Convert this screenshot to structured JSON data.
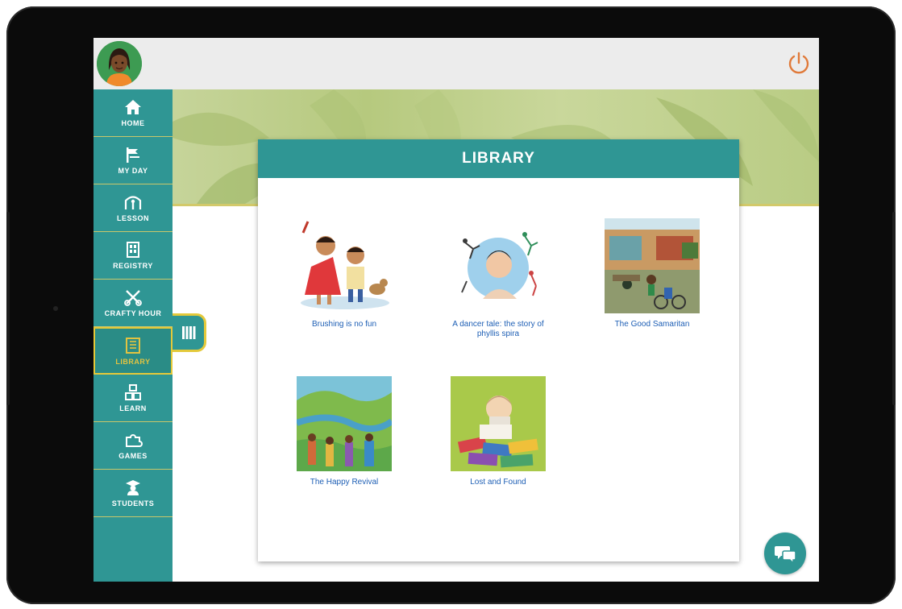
{
  "header": {
    "avatar_icon": "girl-avatar-icon",
    "power_icon": "power-icon",
    "accent_color": "#e07a3a"
  },
  "sidebar": {
    "items": [
      {
        "label": "HOME",
        "icon": "home-icon"
      },
      {
        "label": "MY DAY",
        "icon": "my-day-icon"
      },
      {
        "label": "LESSON",
        "icon": "lesson-icon"
      },
      {
        "label": "REGISTRY",
        "icon": "registry-icon"
      },
      {
        "label": "CRAFTY HOUR",
        "icon": "crafty-hour-icon"
      },
      {
        "label": "LIBRARY",
        "icon": "library-icon",
        "active": true
      },
      {
        "label": "LEARN",
        "icon": "learn-icon"
      },
      {
        "label": "GAMES",
        "icon": "games-icon"
      },
      {
        "label": "STUDENTS",
        "icon": "students-icon"
      }
    ],
    "color": "#2f9694",
    "active_color": "#e2c341"
  },
  "library": {
    "title": "LIBRARY",
    "books": [
      {
        "title": "Brushing is no fun"
      },
      {
        "title": "A dancer tale: the story of phyllis spira"
      },
      {
        "title": "The Good Samaritan"
      },
      {
        "title": "The Happy Revival"
      },
      {
        "title": "Lost and Found"
      }
    ]
  },
  "chat": {
    "icon": "chat-bubbles-icon"
  }
}
